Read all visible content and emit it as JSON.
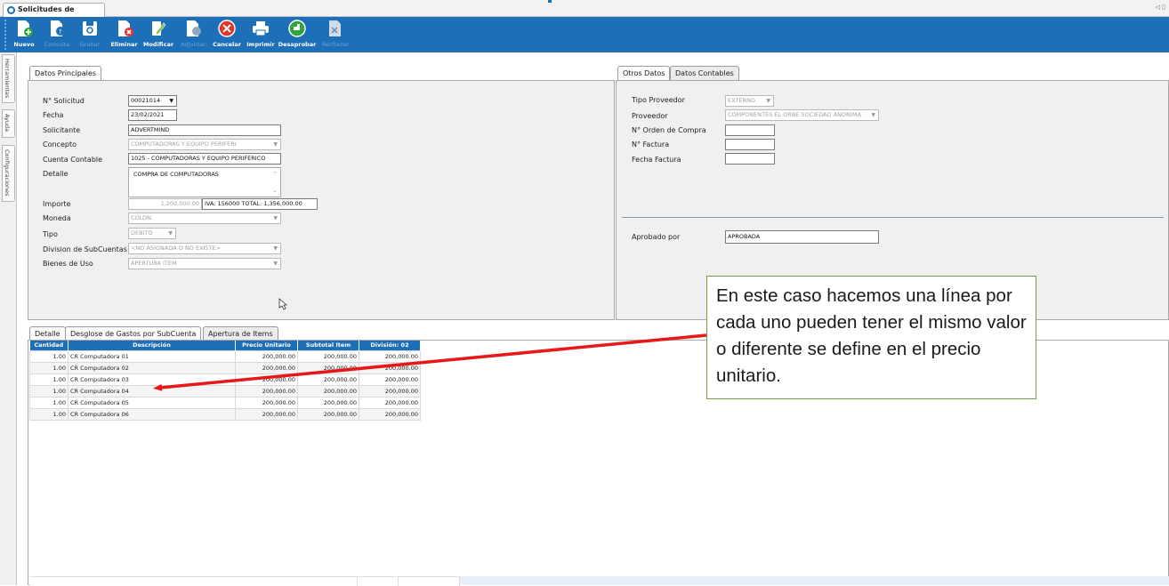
{
  "window": {
    "tab_title": "Solicitudes de Gastos",
    "corner_marks": "◁ ▯"
  },
  "toolbar": {
    "buttons": [
      {
        "label": "Nuevo",
        "enabled": true,
        "icon": "document-add-icon"
      },
      {
        "label": "Consulta",
        "enabled": false,
        "icon": "document-search-icon"
      },
      {
        "label": "Grabar",
        "enabled": false,
        "icon": "save-disk-icon"
      },
      {
        "label": "Eliminar",
        "enabled": true,
        "icon": "document-delete-icon"
      },
      {
        "label": "Modificar",
        "enabled": true,
        "icon": "document-edit-icon"
      },
      {
        "label": "Adjuntar",
        "enabled": false,
        "icon": "document-attach-icon"
      },
      {
        "label": "Cancelar",
        "enabled": true,
        "icon": "cancel-circle-icon"
      },
      {
        "label": "Imprimir",
        "enabled": true,
        "icon": "printer-icon"
      },
      {
        "label": "Desaprobar",
        "enabled": true,
        "icon": "thumb-down-icon"
      },
      {
        "label": "Rechazar",
        "enabled": false,
        "icon": "reject-icon"
      }
    ]
  },
  "sidebar": {
    "tabs": [
      "Herramientas",
      "Ayuda",
      "Configuraciones"
    ]
  },
  "main_panel": {
    "tab": "Datos Principales",
    "fields": {
      "solicitud": {
        "label": "N° Solicitud",
        "value": "00021014"
      },
      "fecha": {
        "label": "Fecha",
        "value": "23/02/2021"
      },
      "solicitante": {
        "label": "Solicitante",
        "value": "ADVERTMIND"
      },
      "concepto": {
        "label": "Concepto",
        "value": "COMPUTADORAS Y EQUIPO PERIFERI"
      },
      "cuenta_contable": {
        "label": "Cuenta Contable",
        "value": "1025 - COMPUTADORAS Y EQUIPO PERIFERICO"
      },
      "detalle": {
        "label": "Detalle",
        "value": "COMPRA DE COMPUTADORAS"
      },
      "importe": {
        "label": "Importe",
        "value": "1,200,000.00",
        "extra": "IVA: 156000 TOTAL:  1,356,000.00"
      },
      "moneda": {
        "label": "Moneda",
        "value": "COLON"
      },
      "tipo": {
        "label": "Tipo",
        "value": "DEBITO"
      },
      "division": {
        "label": "Division de SubCuentas",
        "value": "<NO ASIGNADA O NO EXISTE>"
      },
      "bienes": {
        "label": "Bienes de Uso",
        "value": "APERTURA ITEM"
      }
    }
  },
  "right_panel": {
    "tabs": [
      "Otros Datos",
      "Datos Contables"
    ],
    "fields": {
      "tipo_proveedor": {
        "label": "Tipo Proveedor",
        "value": "EXTERNO"
      },
      "proveedor": {
        "label": "Proveedor",
        "value": "COMPONENTES EL ORBE SOCIEDAD ANONIMA"
      },
      "orden_compra": {
        "label": "N° Orden de Compra",
        "value": ""
      },
      "factura": {
        "label": "N° Factura",
        "value": ""
      },
      "fecha_factura": {
        "label": "Fecha Factura",
        "value": ""
      },
      "aprobado_por": {
        "label": "Aprobado por",
        "value": "APROBADA"
      }
    }
  },
  "detail_tabs": [
    "Detalle",
    "Desglose de Gastos por SubCuenta",
    "Apertura de Items"
  ],
  "grid": {
    "headers": [
      "Cantidad",
      "Descripción",
      "Precio Unitario",
      "Subtotal Item",
      "División: 02"
    ],
    "rows": [
      [
        "1.00",
        "CR  Computadora 01",
        "200,000.00",
        "200,000.00",
        "200,000.00"
      ],
      [
        "1.00",
        "CR  Computadora 02",
        "200,000.00",
        "200,000.00",
        "200,000.00"
      ],
      [
        "1.00",
        "CR  Computadora 03",
        "200,000.00",
        "200,000.00",
        "200,000.00"
      ],
      [
        "1.00",
        "CR  Computadora 04",
        "200,000.00",
        "200,000.00",
        "200,000.00"
      ],
      [
        "1.00",
        "CR  Computadora 05",
        "200,000.00",
        "200,000.00",
        "200,000.00"
      ],
      [
        "1.00",
        "CR  Computadora 06",
        "200,000.00",
        "200,000.00",
        "200,000.00"
      ]
    ]
  },
  "callout": {
    "text": "En este caso hacemos una línea por cada uno pueden tener el mismo valor o diferente se define en el precio unitario."
  },
  "colors": {
    "accent": "#1d6fb8",
    "arrow": "#e81818",
    "callout_border": "#70a043"
  }
}
